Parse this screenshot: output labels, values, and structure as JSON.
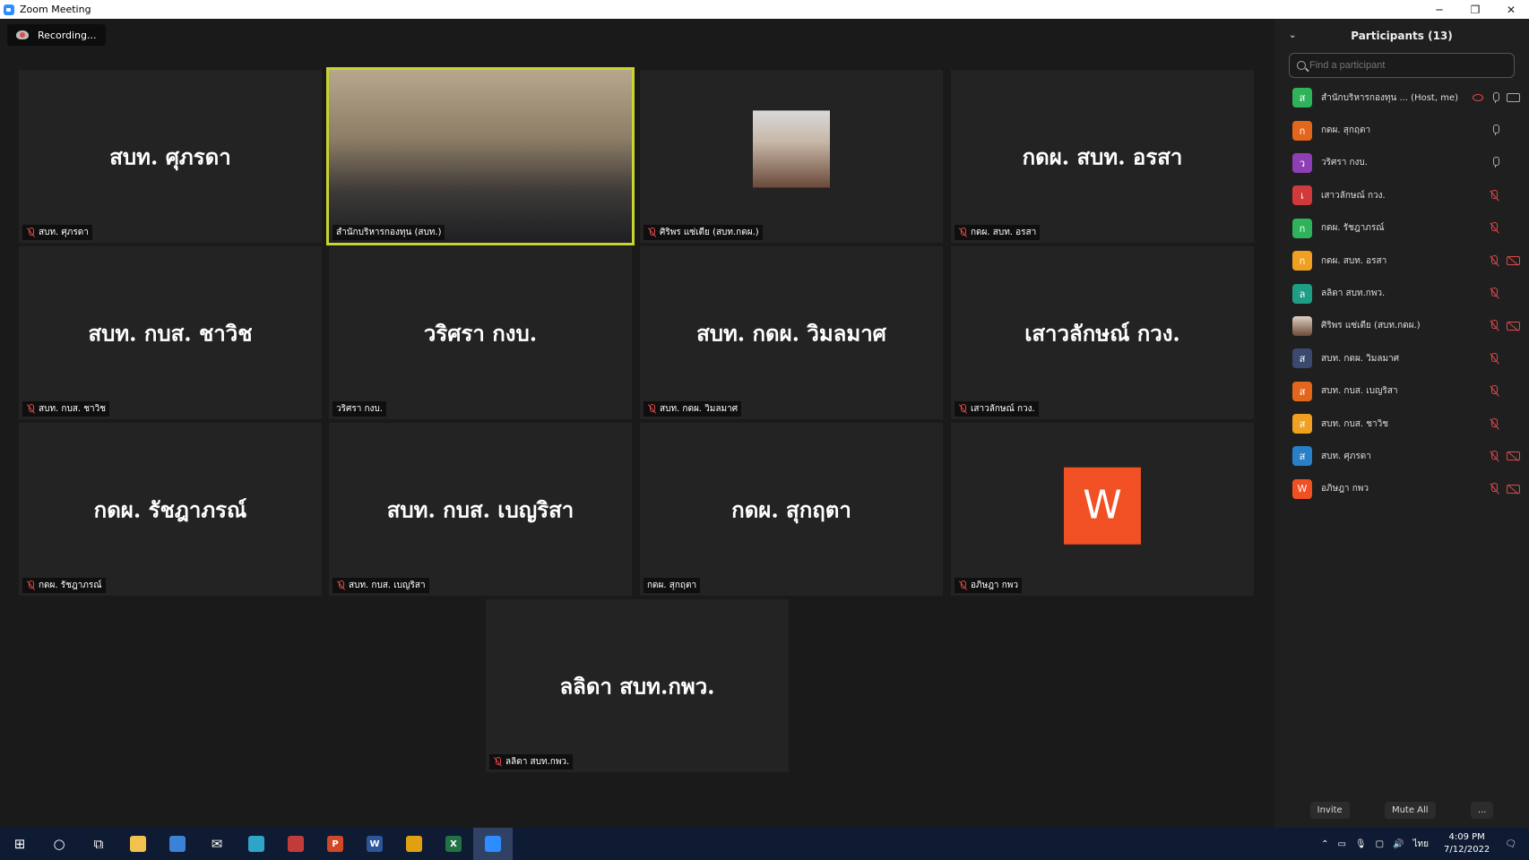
{
  "window": {
    "title": "Zoom Meeting",
    "controls": [
      "─",
      "❐",
      "✕"
    ]
  },
  "recording": {
    "label": "Recording..."
  },
  "tiles": [
    {
      "big": "สบท. ศุภรดา",
      "label": "สบท. ศุภรดา",
      "muted": true
    },
    {
      "big": "",
      "label": "สำนักบริหารกองทุน (สบท.)",
      "muted": false,
      "video": true
    },
    {
      "big": "",
      "label": "ศิริพร แซ่เตีย (สบท.กดผ.)",
      "muted": true,
      "photo": true
    },
    {
      "big": "กดผ. สบท. อรสา",
      "label": "กดผ. สบท. อรสา",
      "muted": true
    },
    {
      "big": "สบท. กบส. ชาวิช",
      "label": "สบท. กบส. ชาวิช",
      "muted": true
    },
    {
      "big": "วริศรา กงบ.",
      "label": "วริศรา กงบ.",
      "muted": false
    },
    {
      "big": "สบท. กดผ. วิมลมาศ",
      "label": "สบท. กดผ. วิมลมาศ",
      "muted": true
    },
    {
      "big": "เสาวลักษณ์ กวง.",
      "label": "เสาวลักษณ์ กวง.",
      "muted": true
    },
    {
      "big": "กดผ. รัชฎาภรณ์",
      "label": "กดผ. รัชฎาภรณ์",
      "muted": true
    },
    {
      "big": "สบท. กบส. เบญริสา",
      "label": "สบท. กบส. เบญริสา",
      "muted": true
    },
    {
      "big": "กดผ. สุกฤตา",
      "label": "กดผ. สุกฤตา",
      "muted": false
    },
    {
      "big": "",
      "label": "อภิษฎา กพว",
      "muted": true,
      "letter": "W"
    },
    {
      "big": "ลลิดา สบท.กพว.",
      "label": "ลลิดา สบท.กพว.",
      "muted": true
    }
  ],
  "panel": {
    "title": "Participants (13)",
    "search_placeholder": "Find a participant",
    "participants": [
      {
        "initial": "ส",
        "color": "#2fb35a",
        "name": "สำนักบริหารกองทุน ... (Host, me)",
        "mic": "on",
        "cam": "on",
        "share": true
      },
      {
        "initial": "ก",
        "color": "#e2661b",
        "name": "กดผ. สุกฤตา",
        "mic": "on",
        "cam": "none"
      },
      {
        "initial": "ว",
        "color": "#8e3fb5",
        "name": "วริศรา กงบ.",
        "mic": "on",
        "cam": "none"
      },
      {
        "initial": "เ",
        "color": "#d03a3a",
        "name": "เสาวลักษณ์ กวง.",
        "mic": "off",
        "cam": "none"
      },
      {
        "initial": "ก",
        "color": "#2fb35a",
        "name": "กดผ. รัชฎาภรณ์",
        "mic": "off",
        "cam": "none"
      },
      {
        "initial": "ก",
        "color": "#f0a020",
        "name": "กดผ. สบท. อรสา",
        "mic": "off",
        "cam": "off"
      },
      {
        "initial": "ล",
        "color": "#1f9e86",
        "name": "ลลิดา สบท.กพว.",
        "mic": "off",
        "cam": "none"
      },
      {
        "initial": "",
        "color": "#b8a090",
        "name": "ศิริพร แซ่เตีย (สบท.กดผ.)",
        "mic": "off",
        "cam": "off",
        "photo": true
      },
      {
        "initial": "ส",
        "color": "#3a4a6e",
        "name": "สบท. กดผ. วิมลมาศ",
        "mic": "off",
        "cam": "none"
      },
      {
        "initial": "ส",
        "color": "#e2661b",
        "name": "สบท. กบส. เบญริสา",
        "mic": "off",
        "cam": "none"
      },
      {
        "initial": "ส",
        "color": "#f0a020",
        "name": "สบท. กบส. ชาวิช",
        "mic": "off",
        "cam": "none"
      },
      {
        "initial": "ส",
        "color": "#2a7fc9",
        "name": "สบท. ศุภรดา",
        "mic": "off",
        "cam": "off"
      },
      {
        "initial": "W",
        "color": "#f05023",
        "name": "อภิษฎา กพว",
        "mic": "off",
        "cam": "off"
      }
    ],
    "footer": {
      "invite": "Invite",
      "mute_all": "Mute All",
      "more": "..."
    }
  },
  "taskbar": {
    "apps": [
      {
        "name": "start",
        "glyph": "⊞",
        "color": ""
      },
      {
        "name": "search",
        "glyph": "○",
        "color": ""
      },
      {
        "name": "task-view",
        "glyph": "⧉",
        "color": ""
      },
      {
        "name": "file-explorer",
        "glyph": "",
        "color": "#f2c14e"
      },
      {
        "name": "store",
        "glyph": "",
        "color": "#3b82d6"
      },
      {
        "name": "mail",
        "glyph": "✉",
        "color": ""
      },
      {
        "name": "edge",
        "glyph": "",
        "color": "#2fa3c8"
      },
      {
        "name": "app-red",
        "glyph": "",
        "color": "#c23b3b"
      },
      {
        "name": "powerpoint",
        "glyph": "P",
        "color": "#d24726"
      },
      {
        "name": "word",
        "glyph": "W",
        "color": "#2b579a"
      },
      {
        "name": "chrome",
        "glyph": "",
        "color": "#e0a010"
      },
      {
        "name": "excel",
        "glyph": "X",
        "color": "#217346"
      },
      {
        "name": "zoom",
        "glyph": "",
        "color": "#2d8cff",
        "active": true
      }
    ],
    "language": "ไทย",
    "time": "4:09 PM",
    "date": "7/12/2022"
  }
}
